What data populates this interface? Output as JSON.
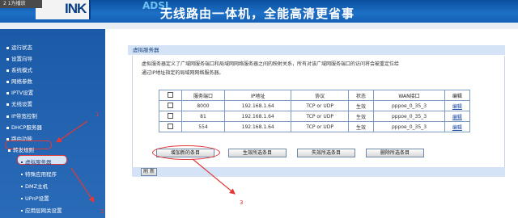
{
  "banner": {
    "player_chip": "2 1为播放",
    "logo": "INK",
    "slogan_en": "ADSL",
    "slogan_zh": "无线路由一体机，全能高清更省事"
  },
  "sidebar": {
    "items": [
      {
        "label": "运行状态"
      },
      {
        "label": "设置向导"
      },
      {
        "label": "系统模式"
      },
      {
        "label": "网络参数"
      },
      {
        "label": "IPTV设置"
      },
      {
        "label": "无线设置"
      },
      {
        "label": "IP带宽控制"
      },
      {
        "label": "DHCP服务器"
      },
      {
        "label": "路由功能"
      },
      {
        "label": "转发规则"
      }
    ],
    "sub_items": [
      {
        "label": "虚拟服务器"
      },
      {
        "label": "特殊应用程序"
      },
      {
        "label": "DMZ主机"
      },
      {
        "label": "UPnP设置"
      },
      {
        "label": "应用层网关设置"
      }
    ]
  },
  "main": {
    "title": "虚拟服务器",
    "description_line1": "虚拟服务器定义了广域网服务端口和局域网网络服务器之间的映射关系，所有对该广域网服务端口的访问将会被重定位给",
    "description_line2": "通过IP地址指定的局域网网络服务器。",
    "table": {
      "headers": [
        "",
        "服务端口",
        "IP地址",
        "协议",
        "状态",
        "WAN接口",
        "编辑"
      ],
      "rows": [
        {
          "port": "8000",
          "ip": "192.168.1.64",
          "protocol": "TCP or UDP",
          "status": "生效",
          "wan": "pppoe_0_35_3",
          "edit": "编辑"
        },
        {
          "port": "81",
          "ip": "192.168.1.64",
          "protocol": "TCP or UDP",
          "status": "生效",
          "wan": "pppoe_0_35_3",
          "edit": "编辑"
        },
        {
          "port": "554",
          "ip": "192.168.1.64",
          "protocol": "TCP or UDP",
          "status": "生效",
          "wan": "pppoe_0_35_3",
          "edit": "编辑"
        }
      ]
    },
    "buttons": {
      "add": "增加新的条目",
      "enable": "生效所选条目",
      "disable": "失效所选条目",
      "delete": "删除所选条目",
      "refresh": "刷 新"
    }
  },
  "annotations": {
    "one": "1",
    "two": "2",
    "three": "3"
  },
  "colors": {
    "banner": "#1d6fc6",
    "sidebar": "#1b5aa6",
    "title_bar": "#d4e3f6",
    "annotation": "#e23838"
  }
}
